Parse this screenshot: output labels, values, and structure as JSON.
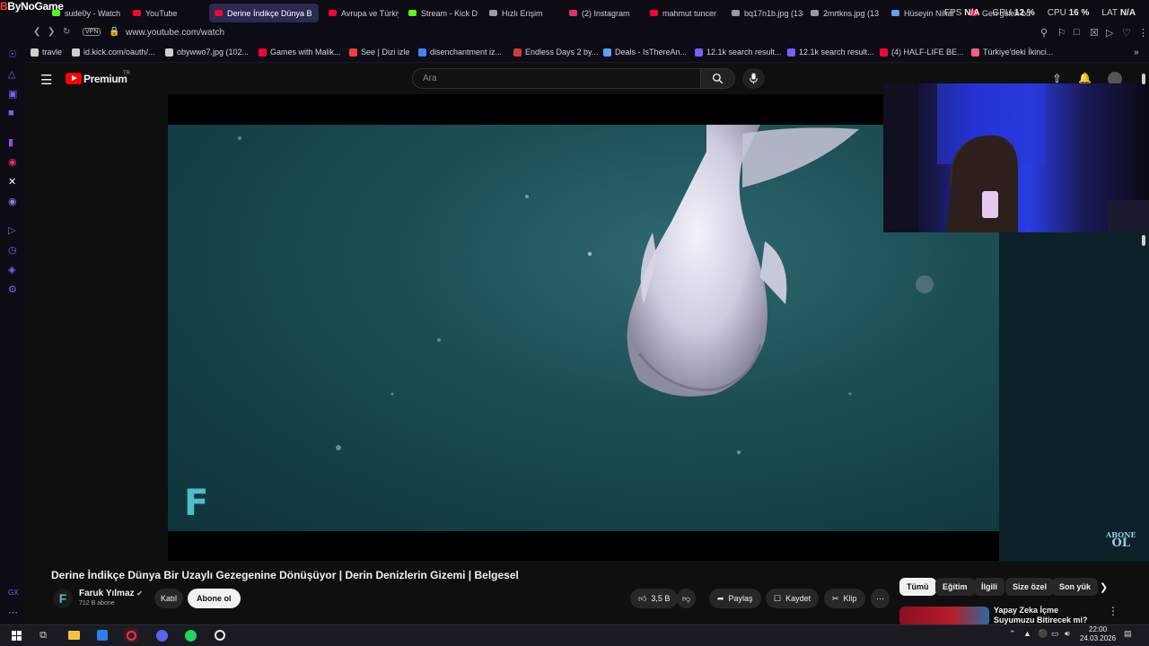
{
  "browser": {
    "brand": "ByNoGame",
    "tabs": [
      {
        "label": "sude0y - Watch",
        "color": "#53fc18"
      },
      {
        "label": "YouTube",
        "color": "#ff0033"
      },
      {
        "label": "Derine İndikçe Dünya B",
        "color": "#ff0033",
        "active": true
      },
      {
        "label": "Avrupa ve Türkiye",
        "color": "#ff0033"
      },
      {
        "label": "Stream - Kick D",
        "color": "#53fc18"
      },
      {
        "label": "Hızlı Erişim",
        "color": "#9a9aa6"
      },
      {
        "label": "(2) Instagram",
        "color": "#e1306c"
      },
      {
        "label": "mahmut tuncer",
        "color": "#ff0033"
      },
      {
        "label": "bq17n1b.jpg (138",
        "color": "#9a9aa6"
      },
      {
        "label": "2mrtkns.jpg (13",
        "color": "#9a9aa6"
      },
      {
        "label": "Hüseyin Nihal",
        "color": "#5aa0ff"
      },
      {
        "label": "Geri gelen bu",
        "color": "#ff0033"
      }
    ],
    "perf": {
      "fps_label": "FPS",
      "fps_value": "N/A",
      "gpu_label": "GPU",
      "gpu_value": "12 %",
      "cpu_label": "CPU",
      "cpu_value": "16 %",
      "lat_label": "LAT",
      "lat_value": "N/A"
    },
    "vpn": "VPN",
    "url": "www.youtube.com/watch",
    "bookmarks": [
      {
        "label": "travle",
        "color": "#cfcfcf"
      },
      {
        "label": "id.kick.com/oauth/...",
        "color": "#cfcfcf"
      },
      {
        "label": "obywwo7.jpg (102...",
        "color": "#cfcfcf"
      },
      {
        "label": "Games with Malik...",
        "color": "#ff0033"
      },
      {
        "label": "See | Dizi izle",
        "color": "#ff3b3b"
      },
      {
        "label": "disenchantment iz...",
        "color": "#4285f4"
      },
      {
        "label": "Endless Days 2 by...",
        "color": "#d23b3b"
      },
      {
        "label": "Deals - IsThereAn...",
        "color": "#5aa0ff"
      },
      {
        "label": "12.1k search result...",
        "color": "#7a5cff"
      },
      {
        "label": "12.1k search result...",
        "color": "#7a5cff"
      },
      {
        "label": "(4) HALF-LIFE BE...",
        "color": "#ff0033"
      },
      {
        "label": "Türkiye'deki İkinci...",
        "color": "#ff5c8a"
      }
    ]
  },
  "youtube": {
    "brand": "Premium",
    "region": "TR",
    "search_placeholder": "Ara",
    "video": {
      "title": "Derine İndikçe Dünya Bir Uzaylı Gezegenine Dönüşüyor | Derin Denizlerin Gizemi | Belgesel",
      "watermark": "F",
      "overlay_top": "ABONE",
      "overlay_bottom": "OL"
    },
    "channel": {
      "avatar_letter": "F",
      "name": "Faruk Yılmaz",
      "subscribers": "712 B abone",
      "join_label": "Katıl",
      "subscribe_label": "Abone ol"
    },
    "actions": {
      "like_count": "3,5 B",
      "share_label": "Paylaş",
      "save_label": "Kaydet",
      "clip_label": "Klip"
    },
    "chips": [
      "Tümü",
      "Eğitim",
      "İlgili",
      "Size özel",
      "Son yük"
    ],
    "recommendation": {
      "title": "Yapay Zeka İçme Suyumuzu Bitirecek mi?"
    }
  },
  "taskbar": {
    "time": "22:00",
    "date": "24.03.2026"
  }
}
